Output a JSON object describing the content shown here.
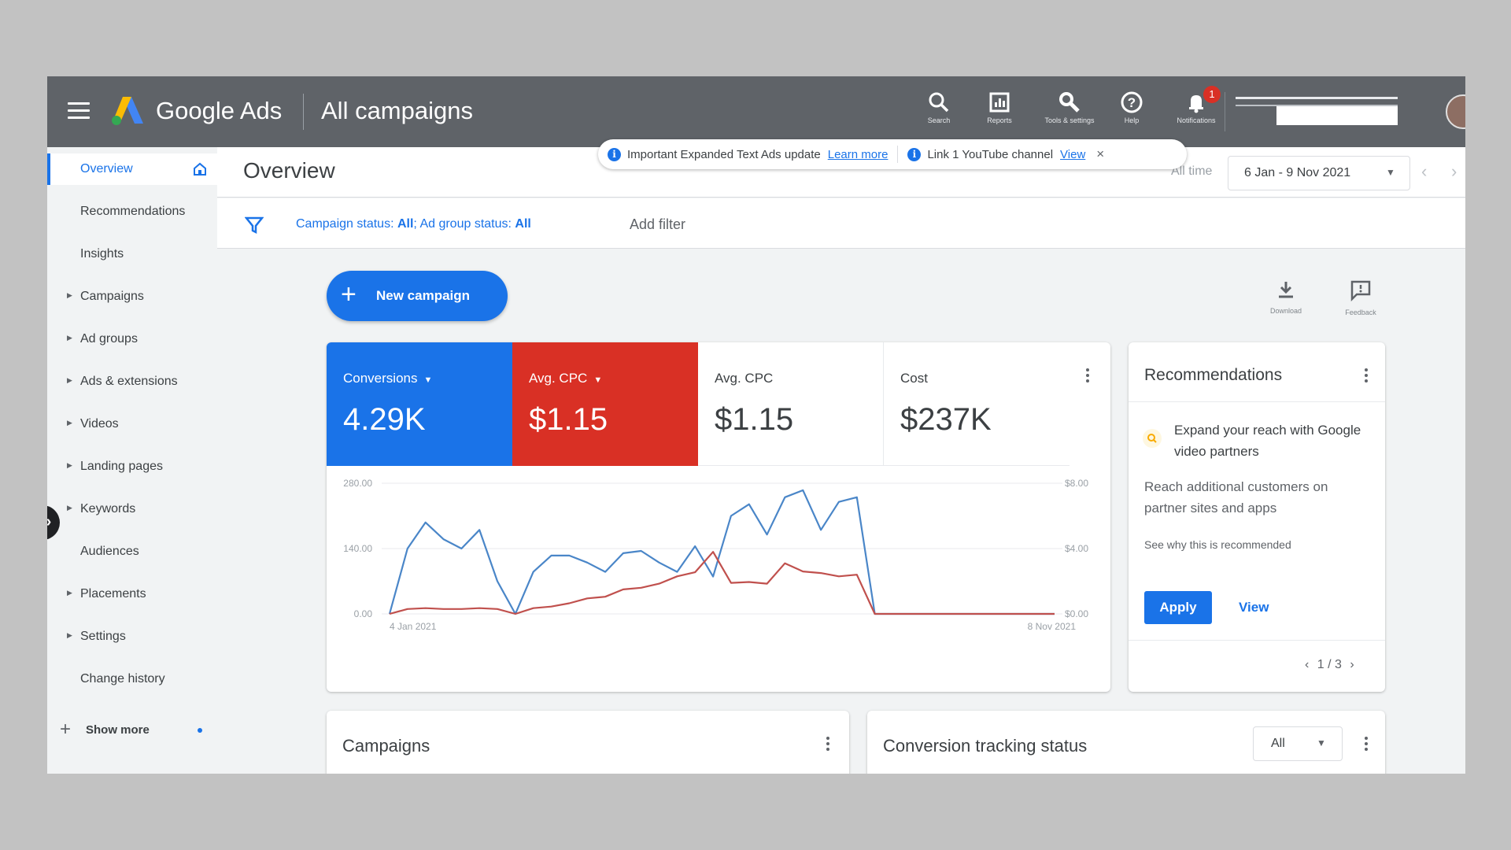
{
  "topbar": {
    "brand": "Google Ads",
    "scope": "All campaigns",
    "tools": [
      {
        "icon": "search-icon",
        "label": "Search"
      },
      {
        "icon": "reports-icon",
        "label": "Reports"
      },
      {
        "icon": "tools-icon",
        "label": "Tools & settings"
      },
      {
        "icon": "help-icon",
        "label": "Help"
      },
      {
        "icon": "bell-icon",
        "label": "Notifications"
      }
    ],
    "notification_count": "1"
  },
  "banner": {
    "message1": "Important Expanded Text Ads update",
    "link1": "Learn more",
    "message2": "Link 1 YouTube channel",
    "link2": "View",
    "close": "×"
  },
  "sidebar": {
    "items": [
      {
        "label": "Overview"
      },
      {
        "label": "Recommendations"
      },
      {
        "label": "Insights"
      },
      {
        "label": "Campaigns"
      },
      {
        "label": "Ad groups"
      },
      {
        "label": "Ads & extensions"
      },
      {
        "label": "Videos"
      },
      {
        "label": "Landing pages"
      },
      {
        "label": "Keywords"
      },
      {
        "label": "Audiences"
      },
      {
        "label": "Placements"
      },
      {
        "label": "Settings"
      },
      {
        "label": "Change history"
      }
    ],
    "collapse": "›",
    "show_more": "Show more"
  },
  "header": {
    "title": "Overview",
    "range_label": "All time",
    "date_range": "6 Jan - 9 Nov 2021"
  },
  "filter": {
    "status_label": "Campaign status:",
    "status_value": "All",
    "adgroup_label": "Ad group status:",
    "adgroup_value": "All",
    "add_filter": "Add filter"
  },
  "actions": {
    "new_campaign": "New campaign",
    "download": "Download",
    "feedback": "Feedback"
  },
  "metrics": [
    {
      "name": "Conversions",
      "value": "4.29K",
      "color": "#1a73e8"
    },
    {
      "name": "Avg. CPC",
      "value": "$1.15",
      "color": "#d93025"
    },
    {
      "name": "Avg. CPC",
      "value": "$1.15"
    },
    {
      "name": "Cost",
      "value": "$237K"
    }
  ],
  "chart_data": {
    "type": "line",
    "x_start": "4 Jan 2021",
    "x_end": "8 Nov 2021",
    "y_left": {
      "ticks": [
        "280.00",
        "140.00",
        "0.00"
      ],
      "range": [
        0,
        280
      ]
    },
    "y_right": {
      "ticks": [
        "$8.00",
        "$4.00",
        "$0.00"
      ],
      "range": [
        0,
        8
      ]
    },
    "grid": true,
    "series": [
      {
        "name": "Conversions",
        "axis": "left",
        "color": "#4a86c8",
        "values": [
          0,
          140,
          196,
          160,
          140,
          180,
          70,
          0,
          90,
          125,
          125,
          110,
          90,
          130,
          135,
          110,
          90,
          145,
          80,
          210,
          235,
          170,
          250,
          265,
          180,
          240,
          250,
          0,
          0,
          0,
          0,
          0,
          0,
          0,
          0,
          0,
          0,
          0
        ]
      },
      {
        "name": "Avg. CPC",
        "axis": "right",
        "color": "#c0504d",
        "values": [
          0,
          0.3,
          0.35,
          0.3,
          0.3,
          0.35,
          0.3,
          0,
          0.35,
          0.45,
          0.65,
          0.95,
          1.05,
          1.5,
          1.6,
          1.85,
          2.3,
          2.55,
          3.8,
          1.9,
          1.95,
          1.85,
          3.1,
          2.6,
          2.5,
          2.3,
          2.4,
          0,
          0,
          0,
          0,
          0,
          0,
          0,
          0,
          0,
          0,
          0
        ]
      }
    ]
  },
  "recommendations": {
    "title": "Recommendations",
    "headline": "Expand your reach with Google video partners",
    "body": "Reach additional customers on partner sites and apps",
    "why": "See why this is recommended",
    "apply": "Apply",
    "view": "View",
    "pager": "1 / 3"
  },
  "bottom": {
    "campaigns_title": "Campaigns",
    "conversion_title": "Conversion tracking status",
    "conversion_filter": "All"
  }
}
